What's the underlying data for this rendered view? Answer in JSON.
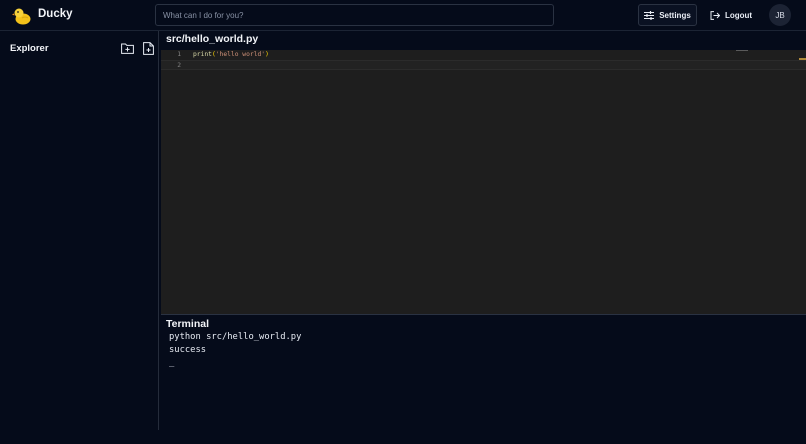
{
  "app": {
    "title": "Ducky",
    "logo_icon": "duck-icon"
  },
  "header": {
    "search_placeholder": "What can I do for you?",
    "settings_label": "Settings",
    "settings_icon": "sliders-icon",
    "logout_label": "Logout",
    "logout_icon": "logout-icon",
    "avatar_initials": "JB"
  },
  "sidebar": {
    "title": "Explorer",
    "new_folder_icon": "folder-plus-icon",
    "new_file_icon": "file-plus-icon"
  },
  "editor": {
    "file_path": "src/hello_world.py",
    "lines": [
      {
        "number": "1",
        "func": "print",
        "open": "(",
        "string": "'hello world'",
        "close": ")"
      },
      {
        "number": "2",
        "text": ""
      }
    ]
  },
  "terminal": {
    "title": "Terminal",
    "lines": [
      "python src/hello_world.py",
      "success",
      "_"
    ]
  },
  "colors": {
    "background": "#050b1a",
    "editor_background": "#1e1e1e",
    "string": "#ce9178",
    "function": "#dcdcaa",
    "bracket": "#ffd700"
  }
}
